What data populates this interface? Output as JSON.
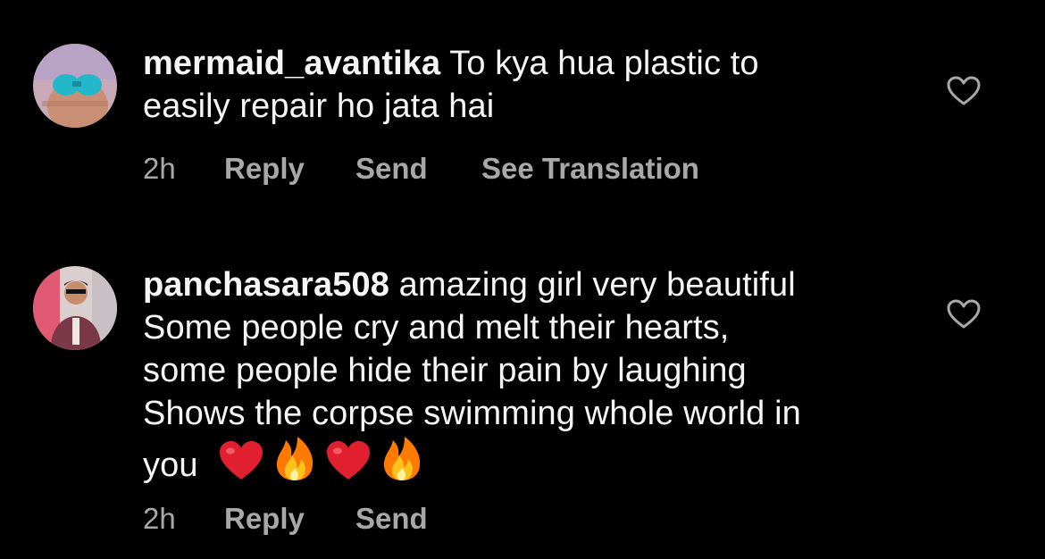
{
  "comments": [
    {
      "username": "mermaid_avantika",
      "lines": [
        "To kya hua plastic to",
        "easily repair ho jata hai"
      ],
      "time": "2h",
      "reply": "Reply",
      "send": "Send",
      "translate": "See Translation",
      "avatar_icon": "user-avatar"
    },
    {
      "username": "panchasara508",
      "lines": [
        "amazing girl very beautiful",
        "Some people cry and melt their hearts,",
        "some people hide their pain by laughing",
        "Shows the corpse swimming whole world in",
        "you"
      ],
      "emojis": [
        "❤️",
        "🔥",
        "❤️",
        "🔥"
      ],
      "time": "2h",
      "reply": "Reply",
      "send": "Send",
      "avatar_icon": "user-avatar"
    }
  ],
  "colors": {
    "background": "#000000",
    "text": "#f5f5f5",
    "secondary": "#a8a8a8",
    "heart_red": "#e0202e",
    "fire_orange": "#ff7a00"
  },
  "icons": {
    "like": "heart-outline-icon",
    "heart_emoji": "red-heart-emoji",
    "fire_emoji": "fire-emoji"
  }
}
